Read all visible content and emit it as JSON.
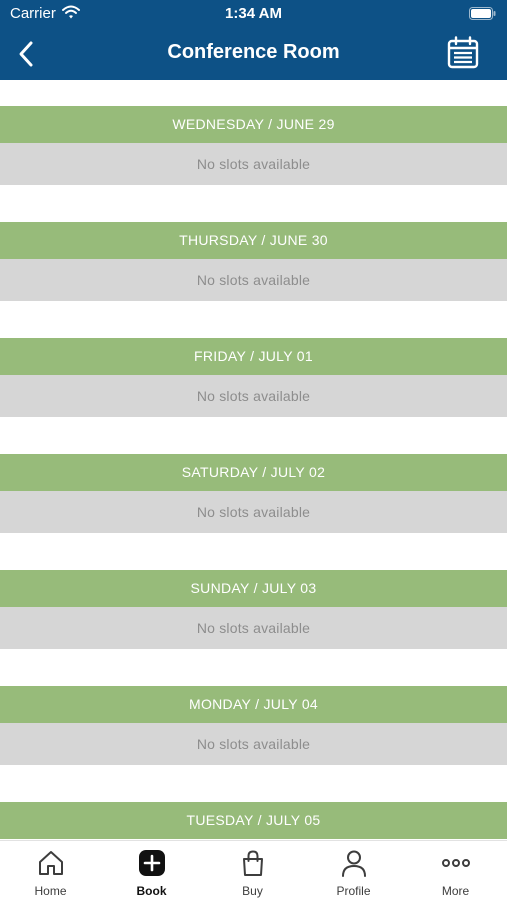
{
  "status_bar": {
    "carrier": "Carrier",
    "time": "1:34 AM"
  },
  "header": {
    "title": "Conference Room",
    "back_icon": "chevron-left-icon",
    "calendar_icon": "calendar-icon"
  },
  "days": [
    {
      "date": "WEDNESDAY / JUNE 29",
      "slots": "No slots available"
    },
    {
      "date": "THURSDAY / JUNE 30",
      "slots": "No slots available"
    },
    {
      "date": "FRIDAY / JULY 01",
      "slots": "No slots available"
    },
    {
      "date": "SATURDAY / JULY 02",
      "slots": "No slots available"
    },
    {
      "date": "SUNDAY / JULY 03",
      "slots": "No slots available"
    },
    {
      "date": "MONDAY / JULY 04",
      "slots": "No slots available"
    },
    {
      "date": "TUESDAY / JULY 05",
      "slots": ""
    }
  ],
  "tabs": [
    {
      "label": "Home",
      "icon": "home-icon"
    },
    {
      "label": "Book",
      "icon": "plus-square-icon",
      "active": true
    },
    {
      "label": "Buy",
      "icon": "shopping-bag-icon"
    },
    {
      "label": "Profile",
      "icon": "person-icon"
    },
    {
      "label": "More",
      "icon": "more-dots-icon"
    }
  ],
  "colors": {
    "header_bg": "#0d5186",
    "day_header_bg": "#97bb7a",
    "slots_bg": "#d6d6d6"
  }
}
